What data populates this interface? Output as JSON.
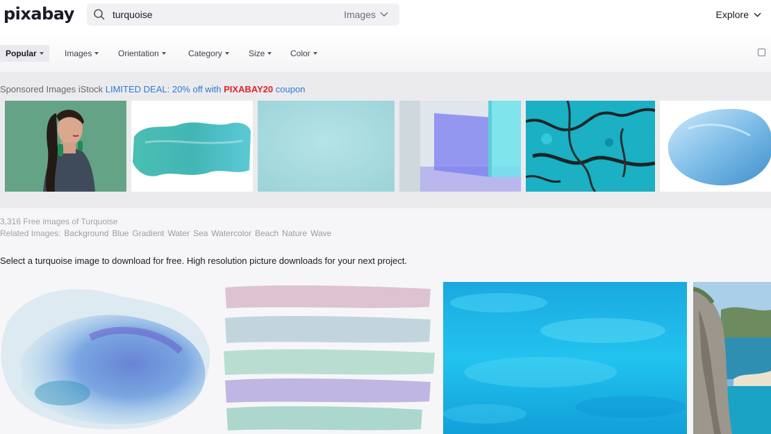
{
  "header": {
    "logo": "pixabay",
    "search_value": "turquoise",
    "search_type": "Images",
    "explore_label": "Explore"
  },
  "filters": {
    "popular": "Popular",
    "images": "Images",
    "orientation": "Orientation",
    "category": "Category",
    "size": "Size",
    "color": "Color"
  },
  "sponsored": {
    "label": "Sponsored Images iStock",
    "deal_prefix": "LIMITED DEAL: 20% off with",
    "code": "PIXABAY20",
    "deal_suffix": "coupon"
  },
  "results": {
    "count_text": "3,316 Free images of Turquoise",
    "related_label": "Related Images:",
    "related_tags": [
      "Background",
      "Blue",
      "Gradient",
      "Water",
      "Sea",
      "Watercolor",
      "Beach",
      "Nature",
      "Wave"
    ],
    "description": "Select a turquoise image to download for free. High resolution picture downloads for your next project."
  },
  "icons": {
    "search": "search-icon",
    "chevron": "chevron-down-icon",
    "caret": "caret-down-icon",
    "checkbox": "checkbox"
  },
  "colors": {
    "accent_blue": "#2d79d6",
    "coupon_red": "#e0242c"
  }
}
